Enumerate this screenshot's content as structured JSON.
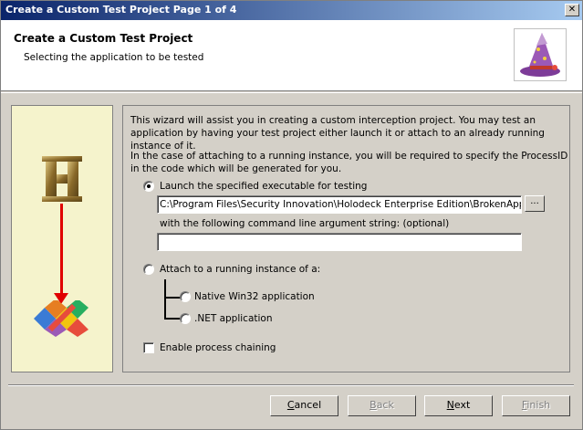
{
  "window": {
    "title": "Create a Custom Test Project Page 1 of 4",
    "close_glyph": "✕"
  },
  "header": {
    "title": "Create a Custom Test Project",
    "subtitle": "Selecting the application to be tested",
    "icon": "wizard-hat-icon"
  },
  "side_panel": {
    "logo_letter": "H",
    "icons": [
      "holodeck-logo-icon",
      "down-arrow-icon",
      "visual-studio-logo-icon"
    ]
  },
  "content": {
    "intro": "This wizard will assist you in creating a custom interception project. You may test an application by having your test project either launch it or attach to an already running instance of it.",
    "attach_note": "In the case of attaching to a running instance, you will be required to specify the ProcessID in the code which will be generated for you.",
    "launch_option": {
      "label": "Launch the specified executable for testing",
      "checked": true
    },
    "exe_path": "C:\\Program Files\\Security Innovation\\Holodeck Enterprise Edition\\BrokenApp\\BrokenApp.exe",
    "browse_label": "...",
    "args_label": "with the following command line argument string: (optional)",
    "args_value": "",
    "attach_option": {
      "label": "Attach to a running instance of a:",
      "checked": false
    },
    "native_option": {
      "label": "Native Win32 application",
      "checked": false
    },
    "dotnet_option": {
      "label": ".NET application",
      "checked": false
    },
    "chaining": {
      "label": "Enable process chaining",
      "checked": false
    }
  },
  "buttons": {
    "cancel_u": "C",
    "cancel_rest": "ancel",
    "back_u": "B",
    "back_rest": "ack",
    "next_u": "N",
    "next_rest": "ext",
    "finish_u": "F",
    "finish_rest": "inish"
  },
  "colors": {
    "accent_arrow": "#e00000",
    "side_panel_bg": "#f5f3cc",
    "title_gradient_start": "#0a246a"
  }
}
